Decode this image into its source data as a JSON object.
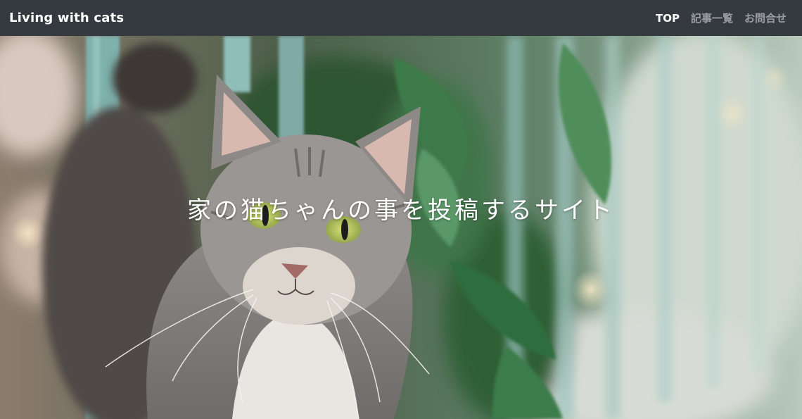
{
  "navbar": {
    "brand": "Living with cats",
    "links": [
      {
        "label": "TOP",
        "active": true
      },
      {
        "label": "記事一覧",
        "active": false
      },
      {
        "label": "お問合せ",
        "active": false
      }
    ]
  },
  "hero": {
    "title": "家の猫ちゃんの事を投稿するサイト",
    "image": "cat-photo"
  },
  "colors": {
    "navbar_bg": "#343a40",
    "nav_text": "#ffffff"
  }
}
